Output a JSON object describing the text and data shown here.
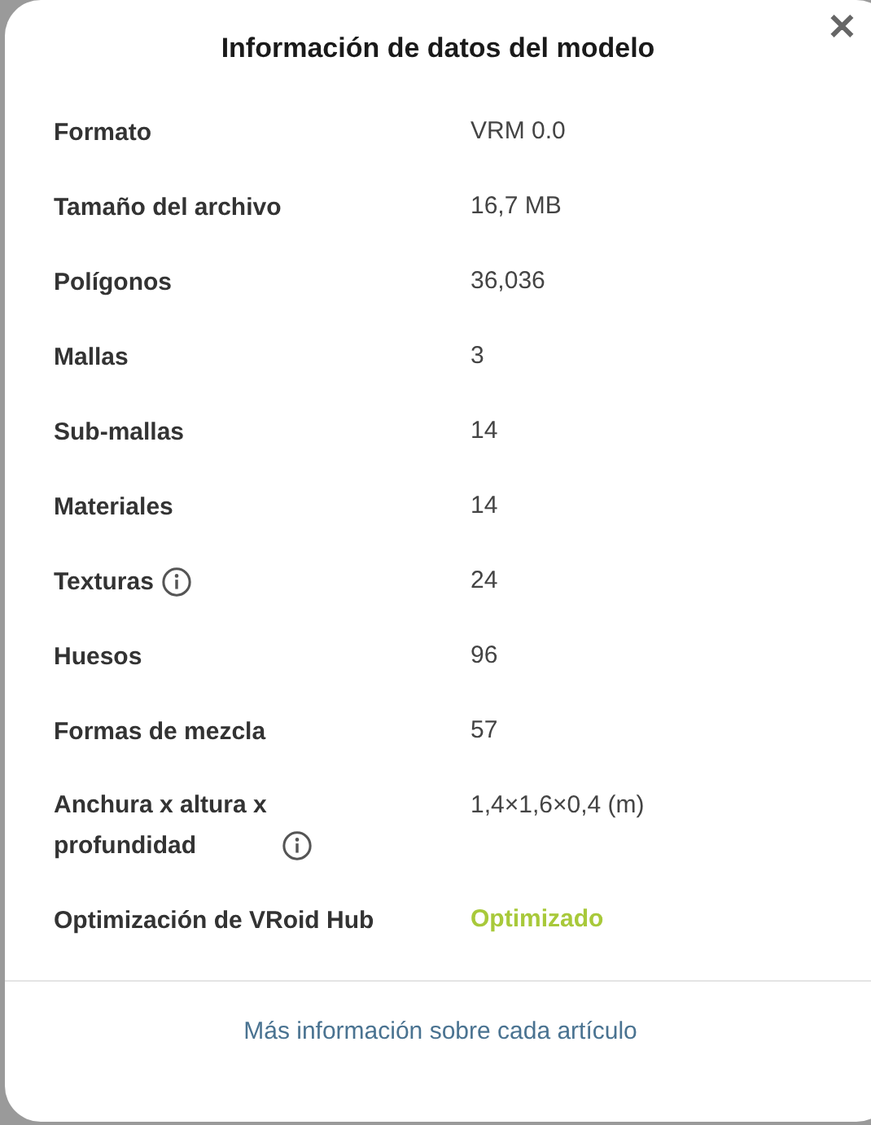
{
  "dialog": {
    "title": "Información de datos del modelo",
    "close": "✕"
  },
  "rows": [
    {
      "label": "Formato",
      "value": "VRM 0.0",
      "info": false,
      "kind": "text"
    },
    {
      "label": "Tamaño del archivo",
      "value": "16,7 MB",
      "info": false,
      "kind": "text"
    },
    {
      "label": "Polígonos",
      "value": "36,036",
      "info": false,
      "kind": "text"
    },
    {
      "label": "Mallas",
      "value": "3",
      "info": false,
      "kind": "text"
    },
    {
      "label": "Sub-mallas",
      "value": "14",
      "info": false,
      "kind": "text"
    },
    {
      "label": "Materiales",
      "value": "14",
      "info": false,
      "kind": "text"
    },
    {
      "label": "Texturas",
      "value": "24",
      "info": true,
      "kind": "text"
    },
    {
      "label": "Huesos",
      "value": "96",
      "info": false,
      "kind": "text"
    },
    {
      "label": "Formas de mezcla",
      "value": "57",
      "info": false,
      "kind": "text"
    },
    {
      "label": "Anchura x altura x profundidad",
      "value": "1,4×1,6×0,4 (m)",
      "info": true,
      "kind": "text"
    },
    {
      "label": "Optimización de VRoid Hub",
      "value": "Optimizado",
      "info": false,
      "kind": "status"
    }
  ],
  "footer_link": "Más información sobre cada artículo"
}
